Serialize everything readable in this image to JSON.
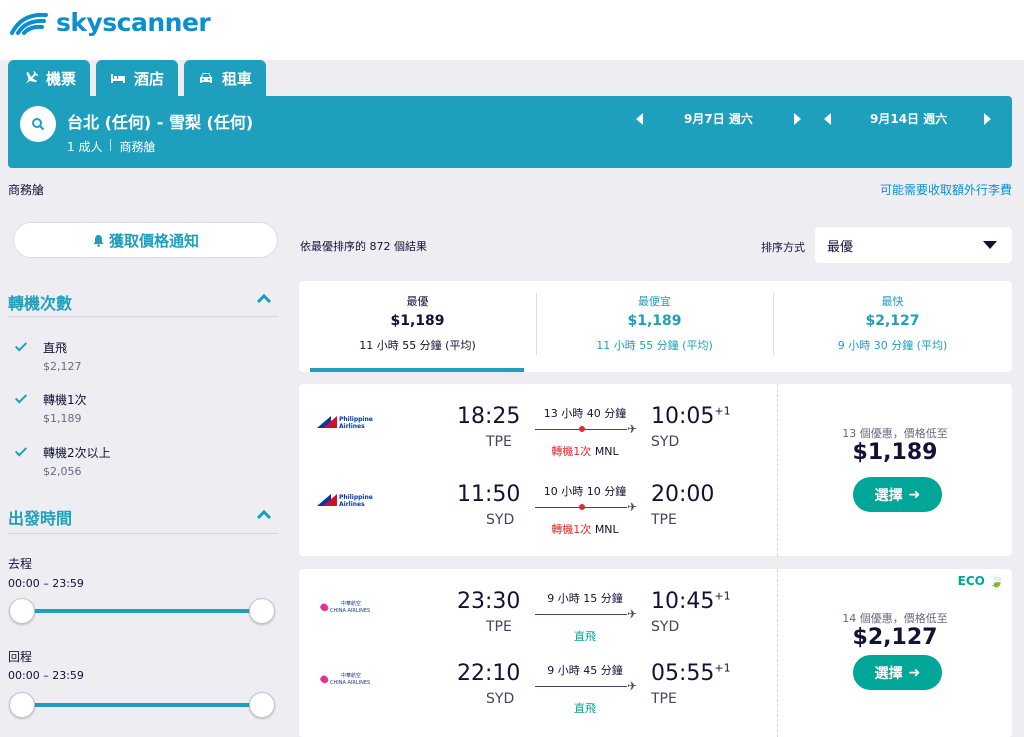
{
  "brand": {
    "name": "skyscanner"
  },
  "tabs": [
    {
      "label": "機票",
      "icon": "plane-icon"
    },
    {
      "label": "酒店",
      "icon": "bed-icon"
    },
    {
      "label": "租車",
      "icon": "car-icon"
    }
  ],
  "search": {
    "route": "台北 (任何) - 雪梨 (任何)",
    "passengers": "1 成人",
    "cabin": "商務艙",
    "depart_date": "9月7日 週六",
    "return_date": "9月14日 週六"
  },
  "info": {
    "cabin_label": "商務艙",
    "baggage_note": "可能需要收取額外行李費"
  },
  "alert_button": "獲取價格通知",
  "filters": {
    "stops_title": "轉機次數",
    "stops": [
      {
        "label": "直飛",
        "price": "$2,127"
      },
      {
        "label": "轉機1次",
        "price": "$1,189"
      },
      {
        "label": "轉機2次以上",
        "price": "$2,056"
      }
    ],
    "departure_title": "出發時間",
    "outbound_label": "去程",
    "outbound_range": "00:00 – 23:59",
    "inbound_label": "回程",
    "inbound_range": "00:00 – 23:59"
  },
  "results": {
    "count_text": "依最優排序的 872 個結果",
    "sort_label": "排序方式",
    "sort_value": "最優"
  },
  "sort_tabs": [
    {
      "title": "最優",
      "price": "$1,189",
      "duration": "11 小時 55 分鐘 (平均)"
    },
    {
      "title": "最便宜",
      "price": "$1,189",
      "duration": "11 小時 55 分鐘 (平均)"
    },
    {
      "title": "最快",
      "price": "$2,127",
      "duration": "9 小時 30 分鐘 (平均)"
    }
  ],
  "cards": [
    {
      "airline": "Philippine Airlines",
      "deals": "13 個優惠，價格低至",
      "price": "$1,189",
      "select_label": "選擇",
      "eco": "",
      "legs": [
        {
          "dep_time": "18:25",
          "dep_code": "TPE",
          "duration": "13 小時 40 分鐘",
          "stops": "轉機1次",
          "via": "MNL",
          "arr_time": "10:05",
          "arr_plus": "+1",
          "arr_code": "SYD"
        },
        {
          "dep_time": "11:50",
          "dep_code": "SYD",
          "duration": "10 小時 10 分鐘",
          "stops": "轉機1次",
          "via": "MNL",
          "arr_time": "20:00",
          "arr_plus": "",
          "arr_code": "TPE"
        }
      ]
    },
    {
      "airline": "China Airlines",
      "deals": "14 個優惠，價格低至",
      "price": "$2,127",
      "select_label": "選擇",
      "eco": "ECO",
      "legs": [
        {
          "dep_time": "23:30",
          "dep_code": "TPE",
          "duration": "9 小時 15 分鐘",
          "stops": "直飛",
          "via": "",
          "arr_time": "10:45",
          "arr_plus": "+1",
          "arr_code": "SYD"
        },
        {
          "dep_time": "22:10",
          "dep_code": "SYD",
          "duration": "9 小時 45 分鐘",
          "stops": "直飛",
          "via": "",
          "arr_time": "05:55",
          "arr_plus": "+1",
          "arr_code": "TPE"
        }
      ]
    }
  ],
  "colors": {
    "teal": "#1e9fbd",
    "green": "#00a698",
    "red": "#e02a2a",
    "brand_blue": "#0b8fd1"
  }
}
